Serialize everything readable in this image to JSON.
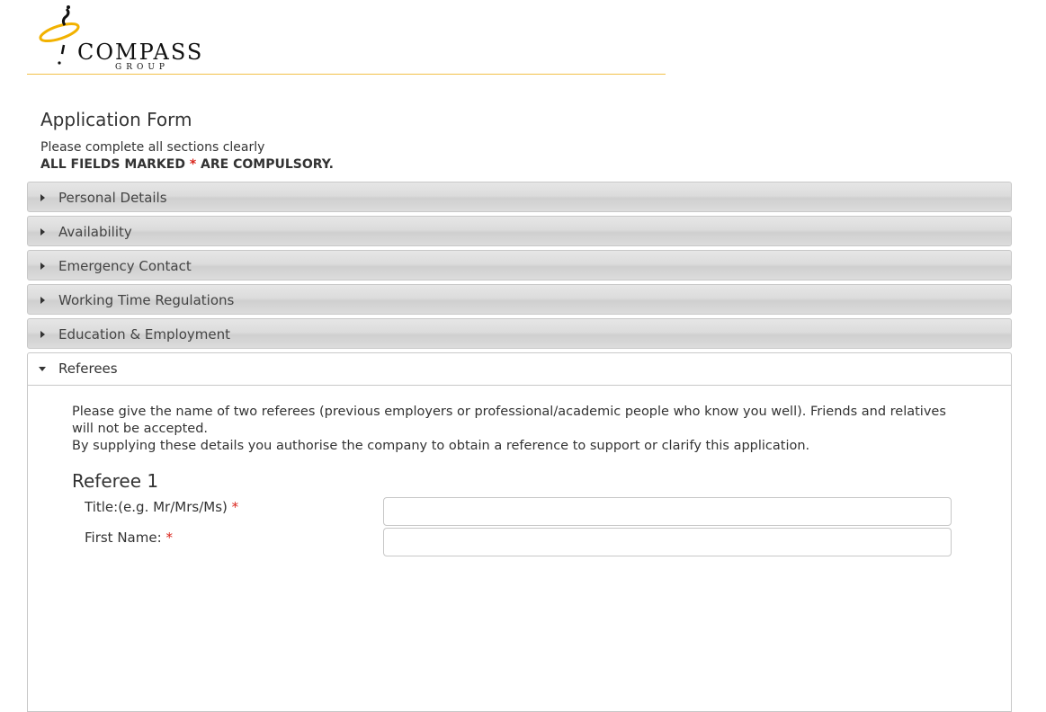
{
  "brand": {
    "name": "COMPASS",
    "sub": "GROUP",
    "accent": "#f2b200"
  },
  "page": {
    "title": "Application Form",
    "instruction": "Please complete all sections clearly",
    "compulsory_prefix": "ALL FIELDS MARKED ",
    "compulsory_star": "*",
    "compulsory_suffix": " ARE COMPULSORY."
  },
  "sections": [
    {
      "label": "Personal Details",
      "expanded": false
    },
    {
      "label": "Availability",
      "expanded": false
    },
    {
      "label": "Emergency Contact",
      "expanded": false
    },
    {
      "label": "Working Time Regulations",
      "expanded": false
    },
    {
      "label": "Education & Employment",
      "expanded": false
    },
    {
      "label": "Referees",
      "expanded": true
    }
  ],
  "referees": {
    "intro1": "Please give the name of two referees (previous employers or professional/academic people who know you well).   Friends and relatives will not be accepted.",
    "intro2": "By supplying these details you authorise the company to obtain a reference to support or clarify this application.",
    "referee1_title": "Referee 1",
    "fields": [
      {
        "label": "Title:(e.g. Mr/Mrs/Ms)",
        "required": "*",
        "value": ""
      },
      {
        "label": "First Name:",
        "required": "*",
        "value": ""
      }
    ]
  }
}
